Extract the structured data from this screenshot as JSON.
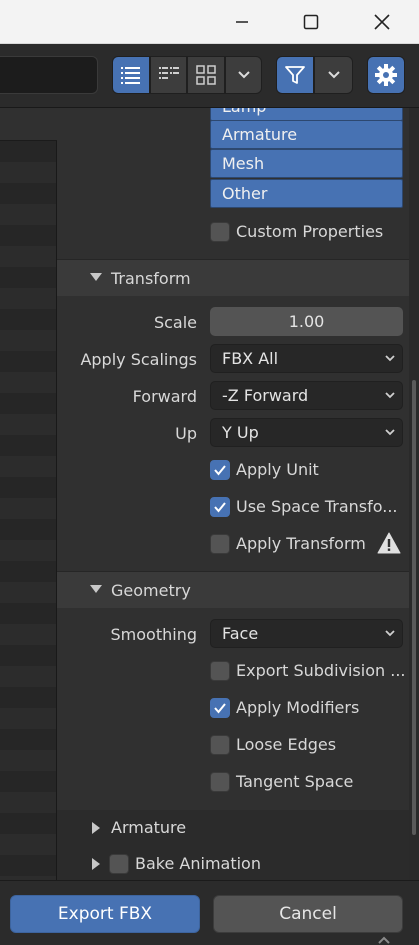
{
  "window": {
    "controls": {
      "minimize_icon": "minimize-icon",
      "maximize_icon": "maximize-icon",
      "close_icon": "close-icon"
    }
  },
  "toolbar": {
    "display_modes": [
      "vertical-list-icon",
      "horizontal-list-icon",
      "thumbnails-icon"
    ],
    "filter_icon": "filter-funnel-icon",
    "settings_icon": "gear-icon",
    "accent": "#4772b3"
  },
  "object_types": {
    "partial_top": "Lamp",
    "items": [
      "Armature",
      "Mesh",
      "Other"
    ]
  },
  "custom_properties": {
    "label": "Custom Properties",
    "checked": false
  },
  "transform": {
    "header": "Transform",
    "scale_label": "Scale",
    "scale_value": "1.00",
    "apply_scalings_label": "Apply Scalings",
    "apply_scalings_value": "FBX All",
    "forward_label": "Forward",
    "forward_value": "-Z Forward",
    "up_label": "Up",
    "up_value": "Y Up",
    "apply_unit": {
      "label": "Apply Unit",
      "checked": true
    },
    "use_space_transform": {
      "label": "Use Space Transfo...",
      "checked": true
    },
    "apply_transform": {
      "label": "Apply Transform",
      "checked": false,
      "icon": "warning-icon"
    }
  },
  "geometry": {
    "header": "Geometry",
    "smoothing_label": "Smoothing",
    "smoothing_value": "Face",
    "export_subdivision": {
      "label": "Export Subdivision ...",
      "checked": false
    },
    "apply_modifiers": {
      "label": "Apply Modifiers",
      "checked": true
    },
    "loose_edges": {
      "label": "Loose Edges",
      "checked": false
    },
    "tangent_space": {
      "label": "Tangent Space",
      "checked": false
    }
  },
  "armature_section": {
    "label": "Armature",
    "expanded": false
  },
  "bake_animation_section": {
    "label": "Bake Animation",
    "checked": false,
    "expanded": false
  },
  "footer": {
    "export_label": "Export FBX",
    "cancel_label": "Cancel"
  }
}
